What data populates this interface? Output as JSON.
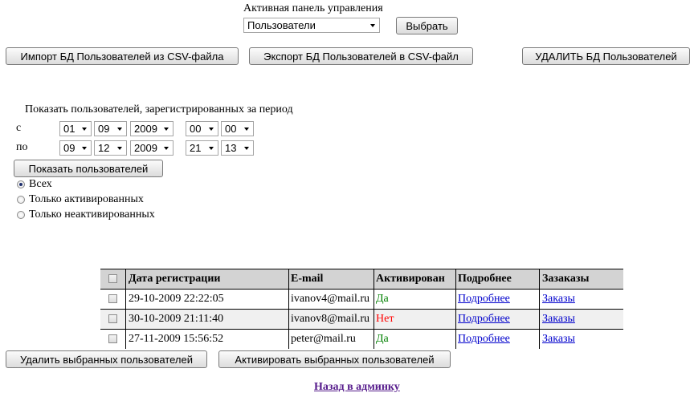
{
  "panel": {
    "label": "Активная панель управления",
    "selected": "Пользователи",
    "select_button": "Выбрать"
  },
  "actions": {
    "import": "Импорт БД Пользователей из CSV-файла",
    "export": "Экспорт БД Пользователей в CSV-файл",
    "delete_db": "УДАЛИТЬ БД Пользователей"
  },
  "period": {
    "title": "Показать пользователей, зарегистрированных за период",
    "from_label": "с",
    "to_label": "по",
    "from": {
      "day": "01",
      "month": "09",
      "year": "2009",
      "hour": "00",
      "minute": "00"
    },
    "to": {
      "day": "09",
      "month": "12",
      "year": "2009",
      "hour": "21",
      "minute": "13"
    },
    "show_button": "Показать пользователей"
  },
  "filter": {
    "options": [
      "Всех",
      "Только активированных",
      "Только неактивированных"
    ],
    "selected_index": 0
  },
  "table": {
    "headers": [
      "Дата регистрации",
      "E-mail",
      "Активирован",
      "Подробнее",
      "Зазаказы"
    ],
    "rows": [
      {
        "date": "29-10-2009 22:22:05",
        "email": "ivanov4@mail.ru",
        "activated": "Да",
        "details": "Подробнее",
        "orders": "Заказы"
      },
      {
        "date": "30-10-2009 21:11:40",
        "email": "ivanov8@mail.ru",
        "activated": "Нет",
        "details": "Подробнее",
        "orders": "Заказы"
      },
      {
        "date": "27-11-2009 15:56:52",
        "email": "peter@mail.ru",
        "activated": "Да",
        "details": "Подробнее",
        "orders": "Заказы"
      }
    ]
  },
  "bottom": {
    "delete_selected": "Удалить выбранных пользователей",
    "activate_selected": "Активировать выбранных пользователей",
    "back_link": "Назад в админку"
  },
  "colors": {
    "yes": "#008000",
    "no": "#ff0000",
    "header_bg": "#d3d3d3",
    "link": "#0000cc",
    "visited_link": "#551a8b"
  }
}
